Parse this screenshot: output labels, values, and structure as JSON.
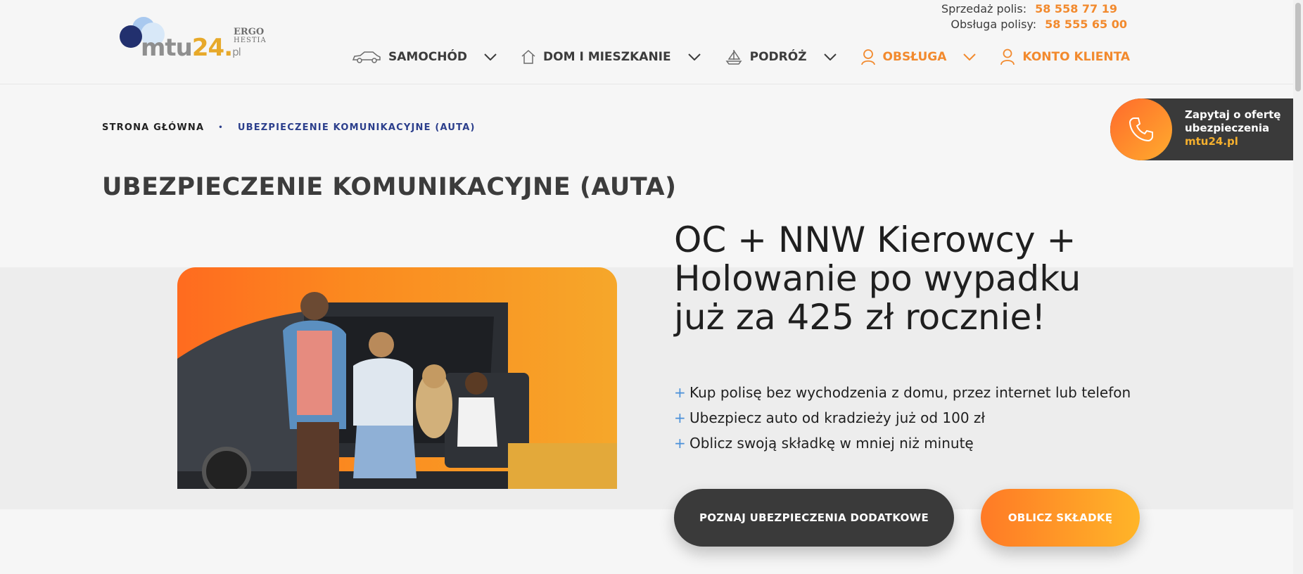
{
  "header": {
    "logo": {
      "word_mtu": "mtu",
      "word_num": "24",
      "word_dot": ".",
      "word_pl": "pl",
      "ergo": "ERGO",
      "hestia": "HESTIA"
    },
    "contact": {
      "sales_label": "Sprzedaż polis:",
      "sales_phone": "58 558 77 19",
      "service_label": "Obsługa polisy:",
      "service_phone": "58 555 65 00"
    },
    "nav": [
      {
        "label": "SAMOCHÓD",
        "icon": "car-icon"
      },
      {
        "label": "DOM I MIESZKANIE",
        "icon": "house-icon"
      },
      {
        "label": "PODRÓŻ",
        "icon": "sailboat-icon"
      },
      {
        "label": "OBSŁUGA",
        "icon": "person-pin-icon"
      },
      {
        "label": "KONTO KLIENTA",
        "icon": "user-icon"
      }
    ]
  },
  "breadcrumb": {
    "home": "STRONA GŁÓWNA",
    "separator": "•",
    "current": "UBEZPIECZENIE KOMUNIKACYJNE (AUTA)"
  },
  "page_title": "UBEZPIECZENIE KOMUNIKACYJNE (AUTA)",
  "ask_card": {
    "line1": "Zapytaj o ofertę",
    "line2": "ubezpieczenia",
    "link": "mtu24.pl"
  },
  "hero": {
    "headline_1": "OC + NNW Kierowcy +",
    "headline_2": "Holowanie po wypadku",
    "headline_3": "już za 425 zł rocznie!",
    "bullets": [
      "Kup polisę bez wychodzenia z domu, przez internet lub telefon",
      "Ubezpiecz auto od kradzieży już od 100 zł",
      "Oblicz swoją składkę w mniej niż minutę"
    ],
    "btn_additional": "POZNAJ UBEZPIECZENIA DODATKOWE",
    "btn_calculate": "OBLICZ SKŁADKĘ"
  },
  "colors": {
    "accent_orange": "#f28a2e",
    "navy": "#2c3f8c",
    "dark": "#3a3a3a",
    "plus_blue": "#4a90d9"
  }
}
